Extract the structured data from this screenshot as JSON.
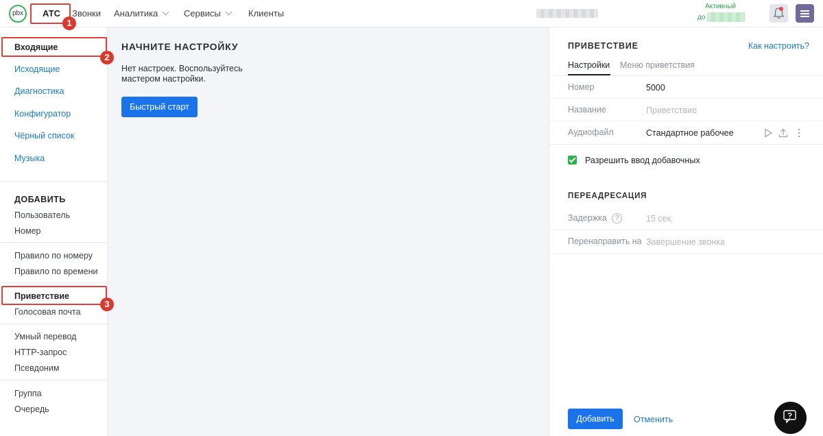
{
  "header": {
    "logo": "pbx",
    "nav": [
      {
        "label": "АТС",
        "active": true
      },
      {
        "label": "Звонки"
      },
      {
        "label": "Аналитика",
        "has_dropdown": true
      },
      {
        "label": "Сервисы",
        "has_dropdown": true
      },
      {
        "label": "Клиенты"
      }
    ],
    "status_label": "Активный",
    "status_until": "до",
    "icons": [
      "bell-icon",
      "hamburger-menu-icon"
    ]
  },
  "annotations": [
    "1",
    "2",
    "3"
  ],
  "sidebar": {
    "main": [
      "Входящие",
      "Исходящие",
      "Диагностика",
      "Конфигуратор",
      "Чёрный список",
      "Музыка"
    ],
    "add_heading": "ДОБАВИТЬ",
    "group1": [
      "Пользователь",
      "Номер"
    ],
    "group2": [
      "Правило по номеру",
      "Правило по времени"
    ],
    "group3": [
      "Приветствие",
      "Голосовая почта"
    ],
    "group4": [
      "Умный перевод",
      "HTTP-запрос",
      "Псевдоним"
    ],
    "group5": [
      "Группа",
      "Очередь"
    ]
  },
  "main": {
    "title": "НАЧНИТЕ НАСТРОЙКУ",
    "text": "Нет настроек. Воспользуйтесь мастером настройки.",
    "quick_start": "Быстрый старт"
  },
  "panel": {
    "title": "ПРИВЕТСТВИЕ",
    "help_link": "Как настроить?",
    "tabs": [
      "Настройки",
      "Меню приветствия"
    ],
    "fields": {
      "number_label": "Номер",
      "number_value": "5000",
      "name_label": "Название",
      "name_placeholder": "Приветствие",
      "audio_label": "Аудиофайл",
      "audio_value": "Стандартное рабочее"
    },
    "allow_ext_label": "Разрешить ввод добавочных",
    "allow_ext_checked": true,
    "redirect_heading": "ПЕРЕАДРЕСАЦИЯ",
    "delay_label": "Задержка",
    "delay_placeholder": "15 сек.",
    "redirect_label": "Перенаправить на",
    "redirect_placeholder": "Завершение звонка",
    "add_button": "Добавить",
    "cancel_button": "Отменить"
  },
  "colors": {
    "accent": "#1a73e8",
    "link": "#1a7bc4",
    "success": "#2fb34b",
    "annotation": "#e0403a"
  }
}
